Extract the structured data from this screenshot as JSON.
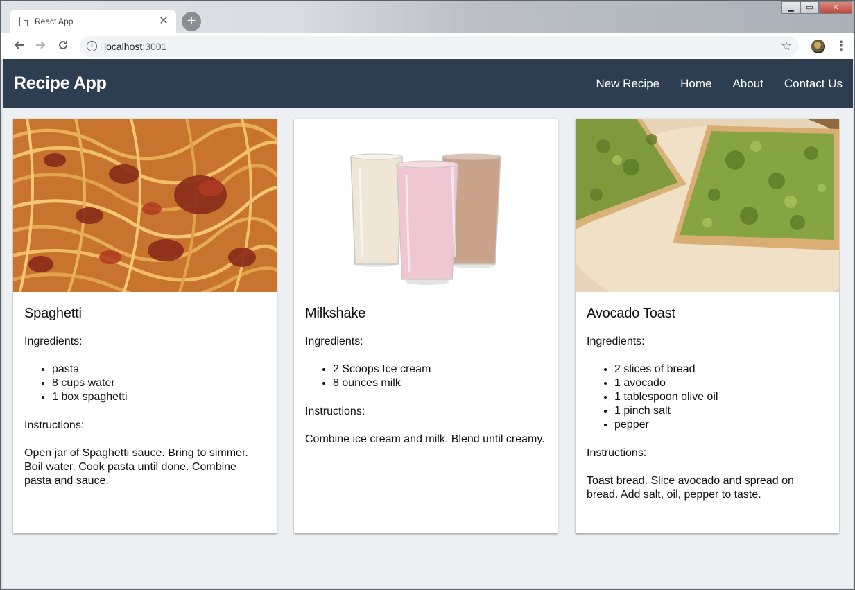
{
  "browser": {
    "tab_title": "React App",
    "new_tab_symbol": "+",
    "close_symbol": "✕",
    "url_host": "localhost",
    "url_port": ":3001",
    "window_controls": {
      "minimize": "▁",
      "maximize": "▭",
      "close": "✕"
    }
  },
  "app": {
    "brand": "Recipe App",
    "nav": [
      "New Recipe",
      "Home",
      "About",
      "Contact Us"
    ]
  },
  "recipes": [
    {
      "title": "Spaghetti",
      "ingredients_label": "Ingredients:",
      "ingredients": [
        "pasta",
        "8 cups water",
        "1 box spaghetti"
      ],
      "instructions_label": "Instructions:",
      "instructions": "Open jar of Spaghetti sauce. Bring to simmer. Boil water. Cook pasta until done. Combine pasta and sauce.",
      "image": "spaghetti-photo"
    },
    {
      "title": "Milkshake",
      "ingredients_label": "Ingredients:",
      "ingredients": [
        "2 Scoops Ice cream",
        "8 ounces milk"
      ],
      "instructions_label": "Instructions:",
      "instructions": "Combine ice cream and milk. Blend until creamy.",
      "image": "milkshake-photo"
    },
    {
      "title": "Avocado Toast",
      "ingredients_label": "Ingredients:",
      "ingredients": [
        "2 slices of bread",
        "1 avocado",
        "1 tablespoon olive oil",
        "1 pinch salt",
        "pepper"
      ],
      "instructions_label": "Instructions:",
      "instructions": "Toast bread. Slice avocado and spread on bread. Add salt, oil, pepper to taste.",
      "image": "avocado-toast-photo"
    }
  ],
  "colors": {
    "appbar": "#2c3e50",
    "page_bg": "#edf0f2",
    "card_bg": "#ffffff"
  }
}
